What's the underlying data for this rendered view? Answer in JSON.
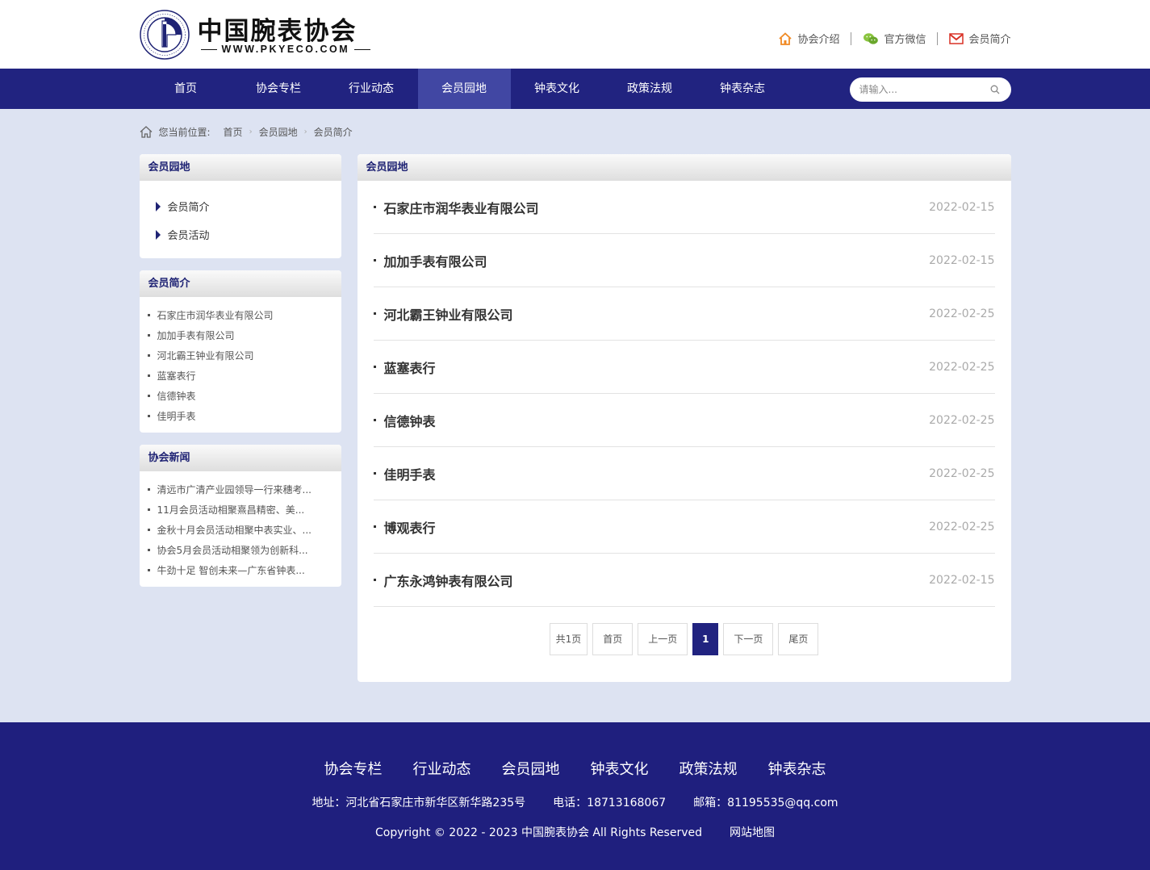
{
  "header": {
    "logo_title": "中国腕表协会",
    "logo_sub": "WWW.PKYECO.COM",
    "top_links": [
      {
        "label": "协会介绍",
        "icon": "home-icon"
      },
      {
        "label": "官方微信",
        "icon": "wechat-icon"
      },
      {
        "label": "会员简介",
        "icon": "mail-icon"
      }
    ]
  },
  "nav": {
    "items": [
      "首页",
      "协会专栏",
      "行业动态",
      "会员园地",
      "钟表文化",
      "政策法规",
      "钟表杂志"
    ],
    "active": "会员园地",
    "search_placeholder": "请输入..."
  },
  "breadcrumb": {
    "label": "您当前位置:",
    "items": [
      "首页",
      "会员园地",
      "会员简介"
    ]
  },
  "sidebar": {
    "section1": {
      "title": "会员园地",
      "items": [
        "会员简介",
        "会员活动"
      ]
    },
    "section2": {
      "title": "会员简介",
      "items": [
        "石家庄市润华表业有限公司",
        "加加手表有限公司",
        "河北霸王钟业有限公司",
        "蓝塞表行",
        "信德钟表",
        "佳明手表"
      ]
    },
    "section3": {
      "title": "协会新闻",
      "items": [
        "清远市广清产业园领导一行来穗考...",
        "11月会员活动相聚熹昌精密、美...",
        "金秋十月会员活动相聚中表实业、...",
        "协会5月会员活动相聚领为创新科...",
        "牛劲十足 智创未来—广东省钟表..."
      ]
    }
  },
  "content": {
    "title": "会员园地",
    "articles": [
      {
        "title": "石家庄市润华表业有限公司",
        "date": "2022-02-15"
      },
      {
        "title": "加加手表有限公司",
        "date": "2022-02-15"
      },
      {
        "title": "河北霸王钟业有限公司",
        "date": "2022-02-25"
      },
      {
        "title": "蓝塞表行",
        "date": "2022-02-25"
      },
      {
        "title": "信德钟表",
        "date": "2022-02-25"
      },
      {
        "title": "佳明手表",
        "date": "2022-02-25"
      },
      {
        "title": "博观表行",
        "date": "2022-02-25"
      },
      {
        "title": "广东永鸿钟表有限公司",
        "date": "2022-02-15"
      }
    ],
    "pager": {
      "info": "共1页",
      "first": "首页",
      "prev": "上一页",
      "current": "1",
      "next": "下一页",
      "last": "尾页"
    }
  },
  "footer": {
    "links": [
      "协会专栏",
      "行业动态",
      "会员园地",
      "钟表文化",
      "政策法规",
      "钟表杂志"
    ],
    "address": "地址：河北省石家庄市新华区新华路235号",
    "phone": "电话：18713168067",
    "email": "邮箱：81195535@qq.com",
    "copyright": "Copyright © 2022 - 2023 中国腕表协会 All Rights Reserved",
    "sitemap": "网站地图"
  },
  "colors": {
    "nav_bg": "#212380",
    "nav_active": "#4147a3",
    "page_bg": "#dde3f2",
    "footer_bg": "#1f1f7e"
  }
}
